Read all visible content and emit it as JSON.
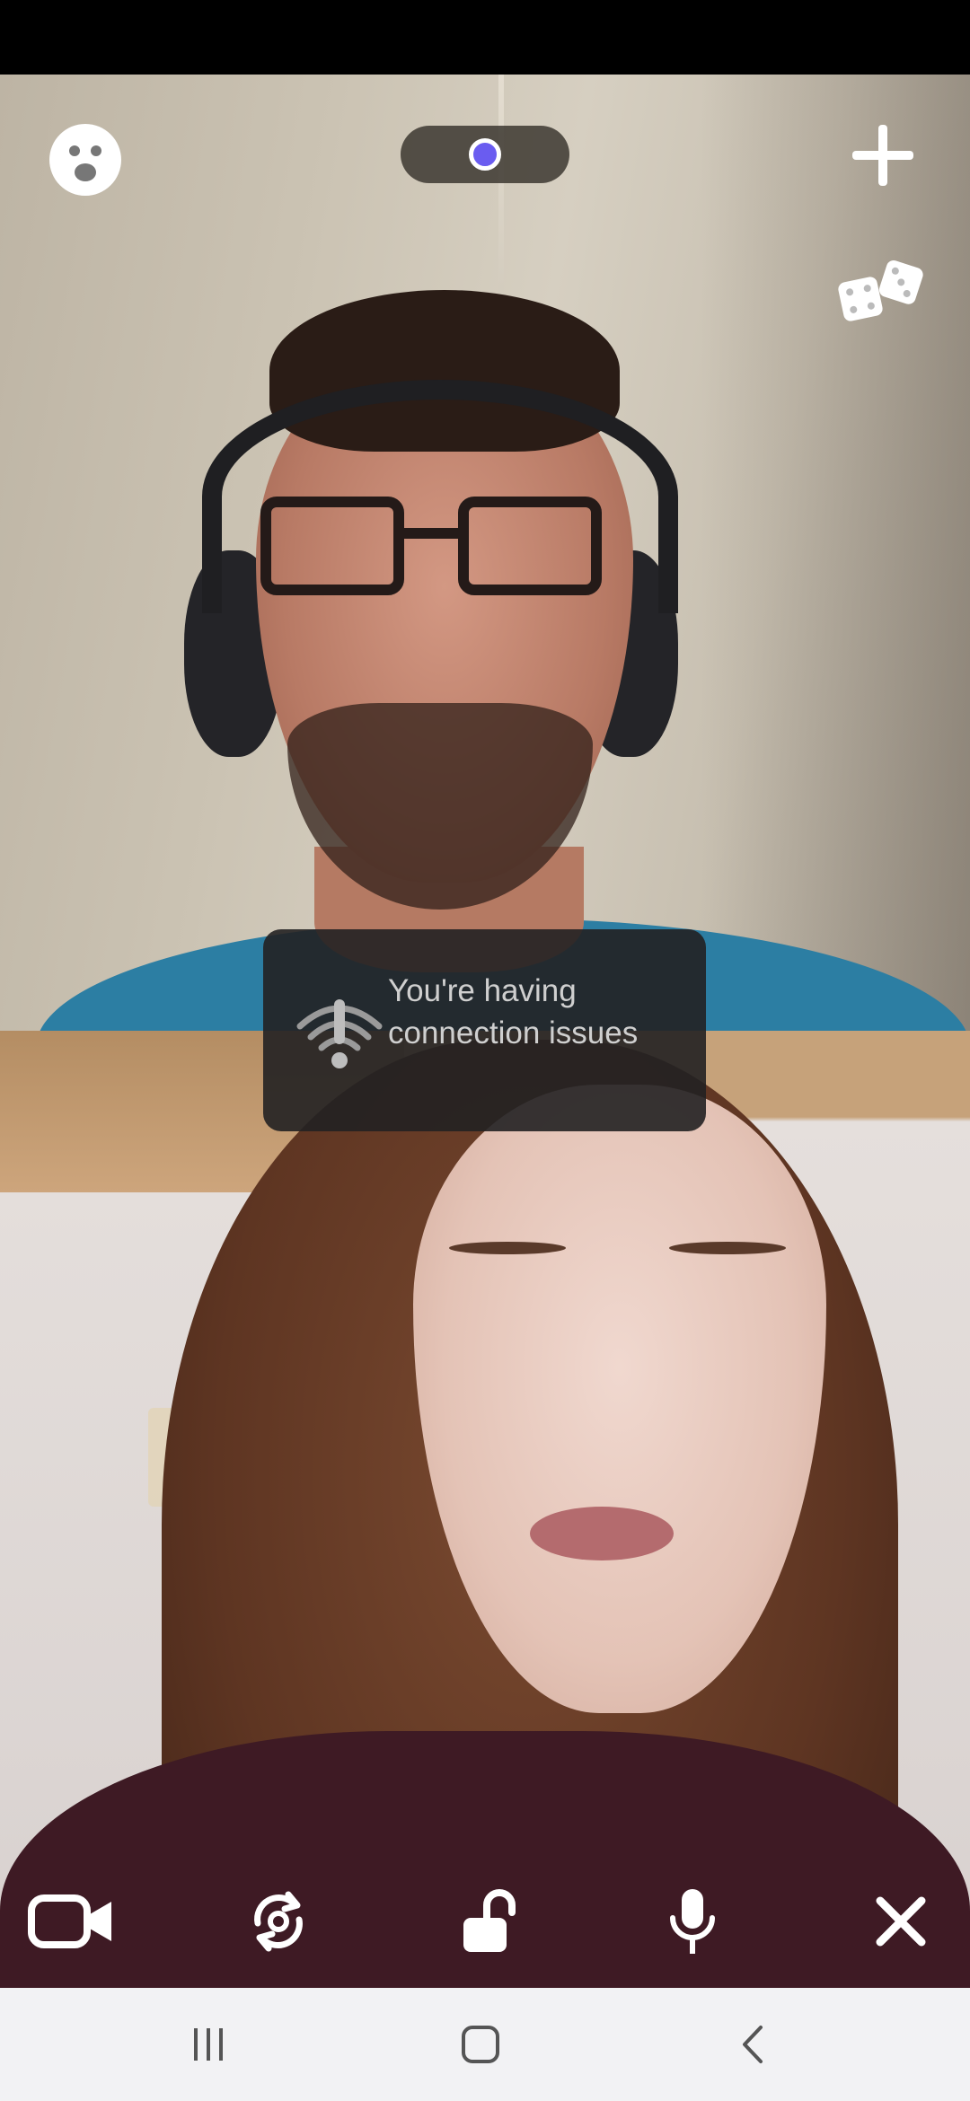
{
  "toast": {
    "icon": "wifi-alert-icon",
    "message": "You're having connection issues"
  },
  "top_bar": {
    "left_button_icon": "emoji-icon",
    "center_indicator_icon": "recording-dot-icon",
    "right_button_icon": "plus-icon",
    "secondary_button_icon": "dice-icon",
    "accent_color": "#6a5cf0"
  },
  "controls": [
    {
      "icon": "video-camera-icon"
    },
    {
      "icon": "switch-camera-icon"
    },
    {
      "icon": "unlock-icon"
    },
    {
      "icon": "microphone-icon"
    },
    {
      "icon": "close-icon"
    }
  ],
  "nav_bar": [
    {
      "icon": "recent-apps-icon"
    },
    {
      "icon": "home-icon"
    },
    {
      "icon": "back-icon"
    }
  ]
}
